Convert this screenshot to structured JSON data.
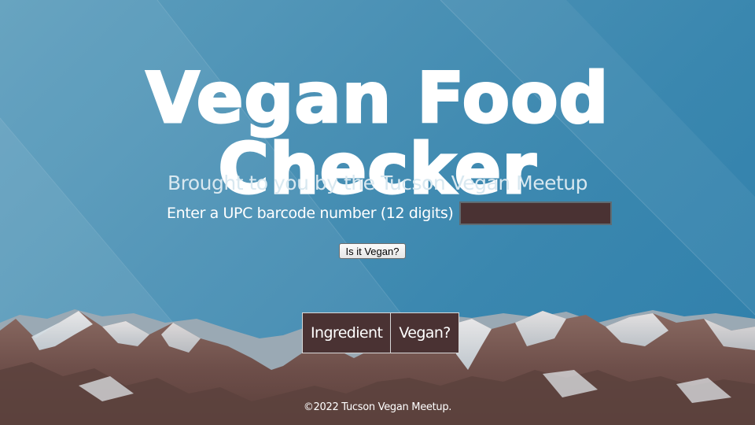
{
  "header": {
    "title_line1": "Vegan Food",
    "title_line2": "Checker",
    "subtitle": "Brought to you by the Tucson Vegan Meetup"
  },
  "form": {
    "upc_label": "Enter a UPC barcode number (12 digits)",
    "upc_value": "",
    "submit_label": "Is it Vegan?"
  },
  "results": {
    "columns": [
      "Ingredient",
      "Vegan?"
    ]
  },
  "footer": {
    "copyright": "©2022 Tucson Vegan Meetup."
  },
  "colors": {
    "sky": "#4b91b5",
    "input_bg": "#4a3233",
    "table_bg": "#4a3233",
    "title": "#ffffff"
  }
}
